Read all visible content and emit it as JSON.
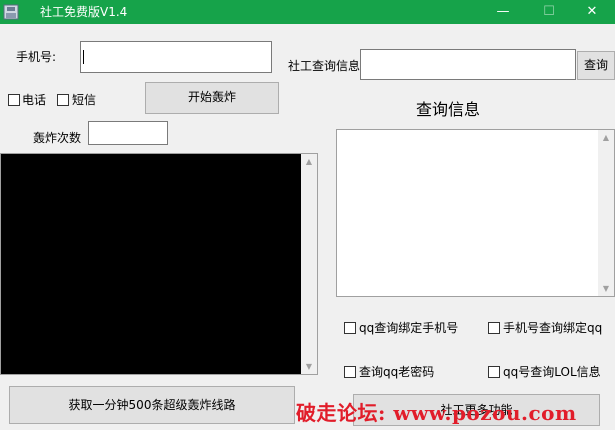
{
  "window": {
    "title": "社工免费版V1.4",
    "minimize_glyph": "—",
    "maximize_glyph": "☐",
    "close_glyph": "✕"
  },
  "colors": {
    "titlebar": "#16a34a",
    "watermark": "#e11d2a"
  },
  "phone": {
    "label": "手机号:",
    "value": ""
  },
  "options": {
    "call_label": "电话",
    "sms_label": "短信"
  },
  "start_button": "开始轰炸",
  "count": {
    "label": "轰炸次数",
    "value": ""
  },
  "query": {
    "label": "社工查询信息",
    "value": "",
    "button": "查询",
    "result_title": "查询信息",
    "result_text": ""
  },
  "query_options": [
    {
      "label": "qq查询绑定手机号",
      "checked": false
    },
    {
      "label": "手机号查询绑定qq",
      "checked": false
    },
    {
      "label": "查询qq老密码",
      "checked": false
    },
    {
      "label": "qq号查询LOL信息",
      "checked": false
    }
  ],
  "bottom": {
    "get_lines_button": "获取一分钟500条超级轰炸线路",
    "more_button": "社工更多功能"
  },
  "watermark": "破走论坛: www.pozou.com",
  "icons": {
    "app": "app-icon",
    "scroll_up": "up-arrow-icon",
    "scroll_down": "down-arrow-icon"
  }
}
